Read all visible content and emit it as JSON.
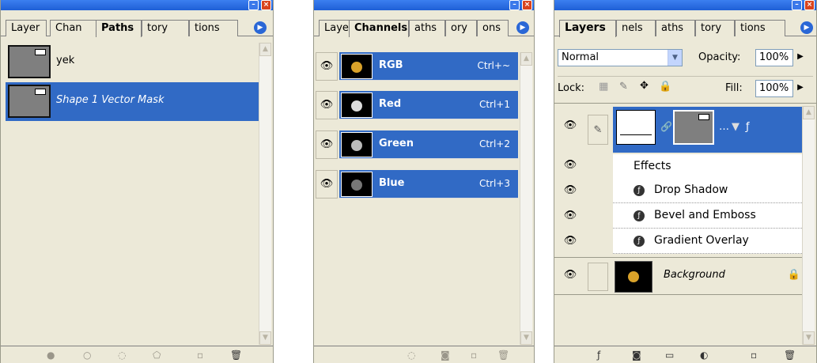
{
  "paths_panel": {
    "tabs": [
      "Layer",
      "Chan",
      "Paths",
      "tory",
      "tions"
    ],
    "items": [
      {
        "label": "yek",
        "selected": false
      },
      {
        "label": "Shape 1 Vector Mask",
        "selected": true
      }
    ]
  },
  "channels_panel": {
    "tabs": [
      "Laye",
      "Channels",
      "aths",
      "ory",
      "ons"
    ],
    "channels": [
      {
        "name": "RGB",
        "shortcut": "Ctrl+~",
        "color": "#d9a22a"
      },
      {
        "name": "Red",
        "shortcut": "Ctrl+1",
        "color": "#dddddd"
      },
      {
        "name": "Green",
        "shortcut": "Ctrl+2",
        "color": "#bbbbbb"
      },
      {
        "name": "Blue",
        "shortcut": "Ctrl+3",
        "color": "#777777"
      }
    ]
  },
  "layers_panel": {
    "tabs": [
      "Layers",
      "nels",
      "aths",
      "tory",
      "tions"
    ],
    "blend_mode": "Normal",
    "opacity_label": "Opacity:",
    "opacity_value": "100%",
    "lock_label": "Lock:",
    "fill_label": "Fill:",
    "fill_value": "100%",
    "effects_label": "Effects",
    "effects": [
      "Drop Shadow",
      "Bevel and Emboss",
      "Gradient Overlay"
    ],
    "background_label": "Background"
  },
  "colors": {
    "selection": "#316AC5",
    "panel_bg": "#ECE9D8",
    "titlebar": "#1f5fd6",
    "close_button": "#d9441f"
  }
}
